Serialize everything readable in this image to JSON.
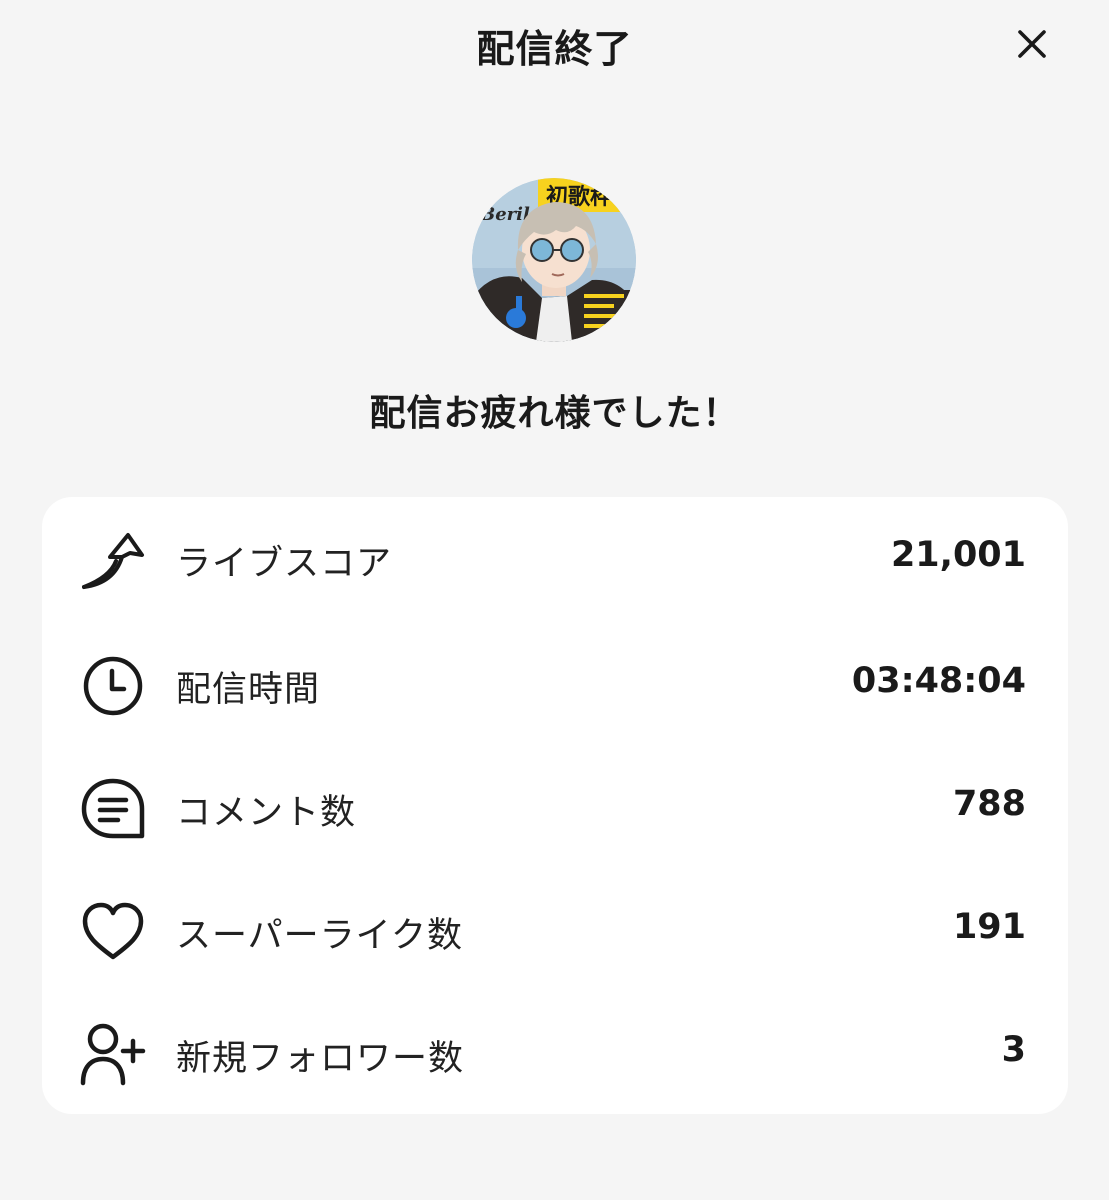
{
  "header": {
    "title": "配信終了"
  },
  "avatar": {
    "badge_text": "初歌枠",
    "name_text": "Beril"
  },
  "main": {
    "message": "配信お疲れ様でした！"
  },
  "stats": [
    {
      "label": "ライブスコア",
      "value": "21,001",
      "icon": "live-score-arrow-icon"
    },
    {
      "label": "配信時間",
      "value": "03:48:04",
      "icon": "clock-icon"
    },
    {
      "label": "コメント数",
      "value": "788",
      "icon": "comment-bubble-icon"
    },
    {
      "label": "スーパーライク数",
      "value": "191",
      "icon": "heart-icon"
    },
    {
      "label": "新規フォロワー数",
      "value": "3",
      "icon": "add-user-icon"
    }
  ]
}
